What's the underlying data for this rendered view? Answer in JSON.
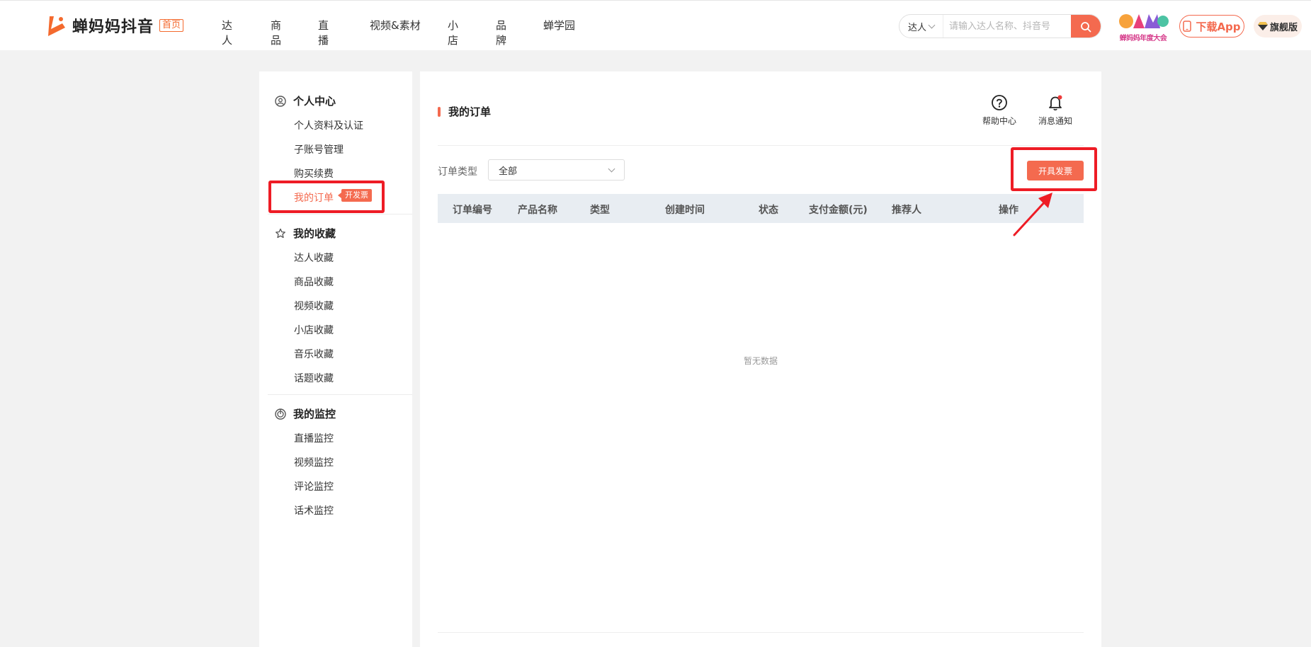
{
  "header": {
    "logo_text": "蝉妈妈抖音",
    "home_tag": "首页",
    "nav": [
      "达人",
      "商品",
      "直播",
      "视频&素材",
      "小店",
      "品牌",
      "蝉学园"
    ],
    "search": {
      "type": "达人",
      "placeholder": "请输入达人名称、抖音号"
    },
    "download_label": "下载App",
    "flagship_label": "旗舰版",
    "game_badge_text": "蝉妈妈年度大会"
  },
  "sidebar": {
    "groups": [
      {
        "title": "个人中心",
        "items": [
          "个人资料及认证",
          "子账号管理",
          "购买续费",
          "我的订单"
        ]
      },
      {
        "title": "我的收藏",
        "items": [
          "达人收藏",
          "商品收藏",
          "视频收藏",
          "小店收藏",
          "音乐收藏",
          "话题收藏"
        ]
      },
      {
        "title": "我的监控",
        "items": [
          "直播监控",
          "视频监控",
          "评论监控",
          "话术监控"
        ]
      }
    ],
    "active_item": "我的订单",
    "invoice_tag": "开发票"
  },
  "main": {
    "title": "我的订单",
    "help_label": "帮助中心",
    "notify_label": "消息通知",
    "filter_label": "订单类型",
    "filter_value": "全部",
    "invoice_button": "开具发票",
    "columns": [
      "订单编号",
      "产品名称",
      "类型",
      "创建时间",
      "状态",
      "支付金额(元)",
      "推荐人",
      "操作"
    ],
    "rows": [],
    "empty_text": "暂无数据"
  },
  "colors": {
    "accent": "#f46a4f",
    "highlight": "#ee1c25",
    "table_header_bg": "#e8edf2",
    "page_bg": "#f2f2f2"
  }
}
